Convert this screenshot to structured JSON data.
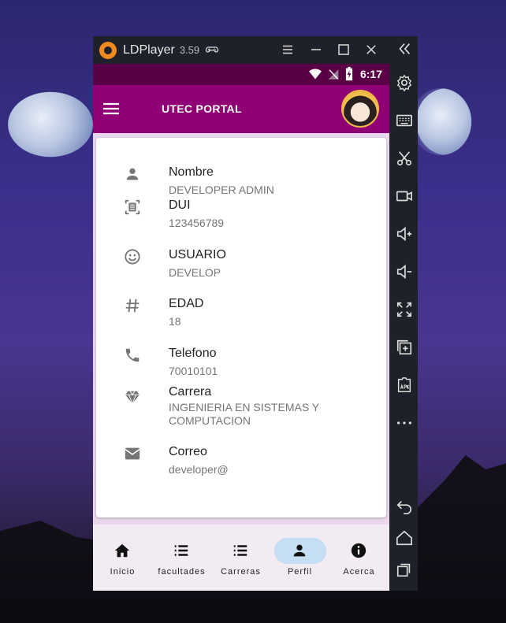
{
  "emulator": {
    "title": "LDPlayer",
    "version": "3.59"
  },
  "status_bar": {
    "time": "6:17"
  },
  "app_bar": {
    "title": "UTEC PORTAL"
  },
  "profile": {
    "fields": [
      {
        "icon": "person-icon",
        "label": "Nombre",
        "value": "DEVELOPER ADMIN"
      },
      {
        "icon": "id-card-icon",
        "label": "DUI",
        "value": "123456789"
      },
      {
        "icon": "smiley-icon",
        "label": "USUARIO",
        "value": "DEVELOP"
      },
      {
        "icon": "hash-icon",
        "label": "EDAD",
        "value": "18"
      },
      {
        "icon": "phone-icon",
        "label": "Telefono",
        "value": "70010101"
      },
      {
        "icon": "diamond-icon",
        "label": "Carrera",
        "value": "INGENIERIA EN SISTEMAS Y COMPUTACION"
      },
      {
        "icon": "mail-icon",
        "label": "Correo",
        "value": "developer@"
      }
    ]
  },
  "bottom_nav": {
    "items": [
      {
        "label": "Inicio",
        "icon": "home-icon"
      },
      {
        "label": "facultades",
        "icon": "list-icon"
      },
      {
        "label": "Carreras",
        "icon": "list-icon"
      },
      {
        "label": "Perfil",
        "icon": "person-icon",
        "active": true
      },
      {
        "label": "Acerca",
        "icon": "info-icon"
      }
    ]
  },
  "colors": {
    "app_bar": "#8e0074",
    "status_bar": "#5a0046",
    "active_nav": "#c5def3"
  }
}
